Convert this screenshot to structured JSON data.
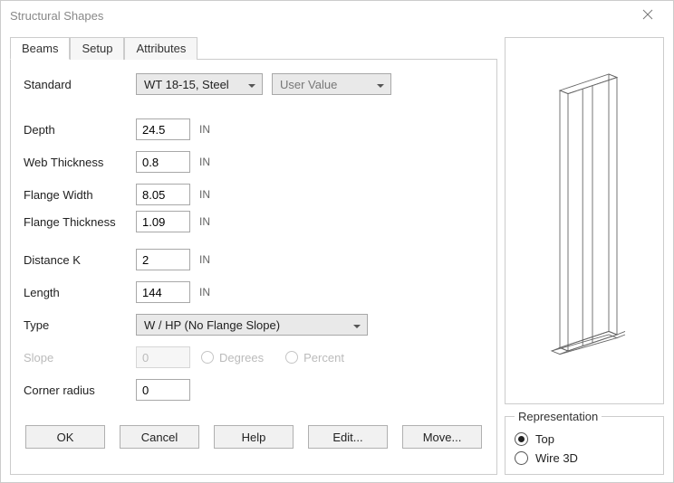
{
  "window": {
    "title": "Structural Shapes"
  },
  "tabs": [
    {
      "label": "Beams",
      "active": true
    },
    {
      "label": "Setup",
      "active": false
    },
    {
      "label": "Attributes",
      "active": false
    }
  ],
  "standard": {
    "label": "Standard",
    "select_value": "WT 18-15, Steel",
    "user_value": "User Value"
  },
  "fields": {
    "depth": {
      "label": "Depth",
      "value": "24.5",
      "unit": "IN"
    },
    "web_thickness": {
      "label": "Web Thickness",
      "value": "0.8",
      "unit": "IN"
    },
    "flange_width": {
      "label": "Flange Width",
      "value": "8.05",
      "unit": "IN"
    },
    "flange_thickness": {
      "label": "Flange Thickness",
      "value": "1.09",
      "unit": "IN"
    },
    "distance_k": {
      "label": "Distance K",
      "value": "2",
      "unit": "IN"
    },
    "length": {
      "label": "Length",
      "value": "144",
      "unit": "IN"
    },
    "type": {
      "label": "Type",
      "value": "W / HP (No Flange Slope)"
    },
    "slope": {
      "label": "Slope",
      "value": "0",
      "unit_degrees": "Degrees",
      "unit_percent": "Percent"
    },
    "corner_radius": {
      "label": "Corner radius",
      "value": "0"
    }
  },
  "buttons": {
    "ok": "OK",
    "cancel": "Cancel",
    "help": "Help",
    "edit": "Edit...",
    "move": "Move..."
  },
  "representation": {
    "legend": "Representation",
    "top": "Top",
    "wire3d": "Wire 3D",
    "selected": "top"
  }
}
